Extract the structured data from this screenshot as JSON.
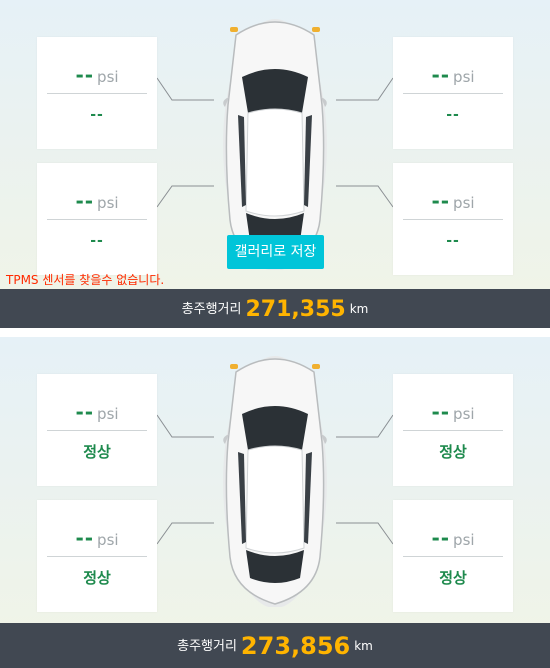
{
  "screens": [
    {
      "tires": {
        "front_left": {
          "pressure": "--",
          "unit": "psi",
          "status": "--"
        },
        "front_right": {
          "pressure": "--",
          "unit": "psi",
          "status": "--"
        },
        "rear_left": {
          "pressure": "--",
          "unit": "psi",
          "status": "--"
        },
        "rear_right": {
          "pressure": "--",
          "unit": "psi",
          "status": "--"
        }
      },
      "gallery_button_label": "갤러리로 저장",
      "warning_text": "TPMS 센서를 찾을수 없습니다.",
      "odometer": {
        "label": "총주행거리",
        "value": "271,355",
        "unit": "km"
      }
    },
    {
      "tires": {
        "front_left": {
          "pressure": "--",
          "unit": "psi",
          "status": "정상"
        },
        "front_right": {
          "pressure": "--",
          "unit": "psi",
          "status": "정상"
        },
        "rear_left": {
          "pressure": "--",
          "unit": "psi",
          "status": "정상"
        },
        "rear_right": {
          "pressure": "--",
          "unit": "psi",
          "status": "정상"
        }
      },
      "odometer": {
        "label": "총주행거리",
        "value": "273,856",
        "unit": "km"
      }
    }
  ],
  "colors": {
    "accent_green": "#1e8a4d",
    "odometer_value": "#ffb400",
    "odometer_bar": "#414852",
    "button": "#00c5d9",
    "warning": "#ff2a00"
  },
  "icons": [
    "car-top-view-icon"
  ]
}
